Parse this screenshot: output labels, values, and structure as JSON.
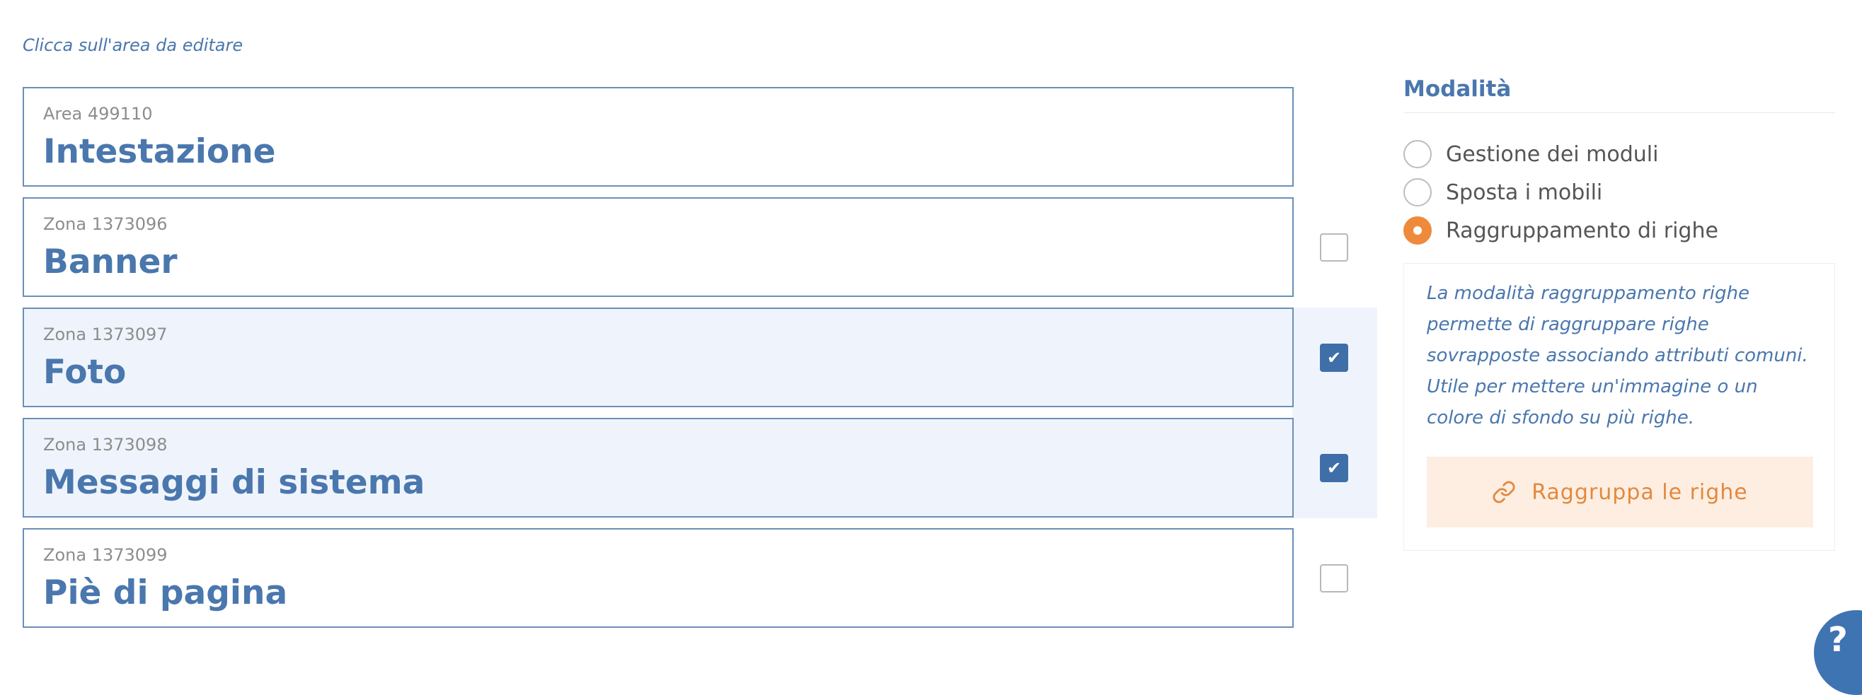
{
  "hint": "Clicca sull'area da editare",
  "rows": [
    {
      "sub": "Area 499110",
      "title": "Intestazione",
      "selected": false,
      "checkbox": null
    },
    {
      "sub": "Zona 1373096",
      "title": "Banner",
      "selected": false,
      "checkbox": false
    },
    {
      "sub": "Zona 1373097",
      "title": "Foto",
      "selected": true,
      "checkbox": true
    },
    {
      "sub": "Zona 1373098",
      "title": "Messaggi di sistema",
      "selected": true,
      "checkbox": true
    },
    {
      "sub": "Zona 1373099",
      "title": "Piè di pagina",
      "selected": false,
      "checkbox": false
    }
  ],
  "sidebar": {
    "title": "Modalità",
    "modes": [
      {
        "label": "Gestione dei moduli",
        "checked": false
      },
      {
        "label": "Sposta i mobili",
        "checked": false
      },
      {
        "label": "Raggruppamento di righe",
        "checked": true
      }
    ],
    "info": "La modalità raggruppamento righe permette di raggruppare righe sovrapposte associando attributi comuni. Utile per mettere un'immagine o un colore di sfondo su più righe.",
    "button_label": "Raggruppa le righe",
    "button_icon": "link-icon"
  },
  "help": {
    "icon": "help-icon",
    "glyph": "?"
  },
  "colors": {
    "accent_blue": "#4a77ad",
    "accent_orange": "#ef8a3c",
    "selected_bg": "#eff4fc",
    "button_bg": "#fdeee1"
  }
}
